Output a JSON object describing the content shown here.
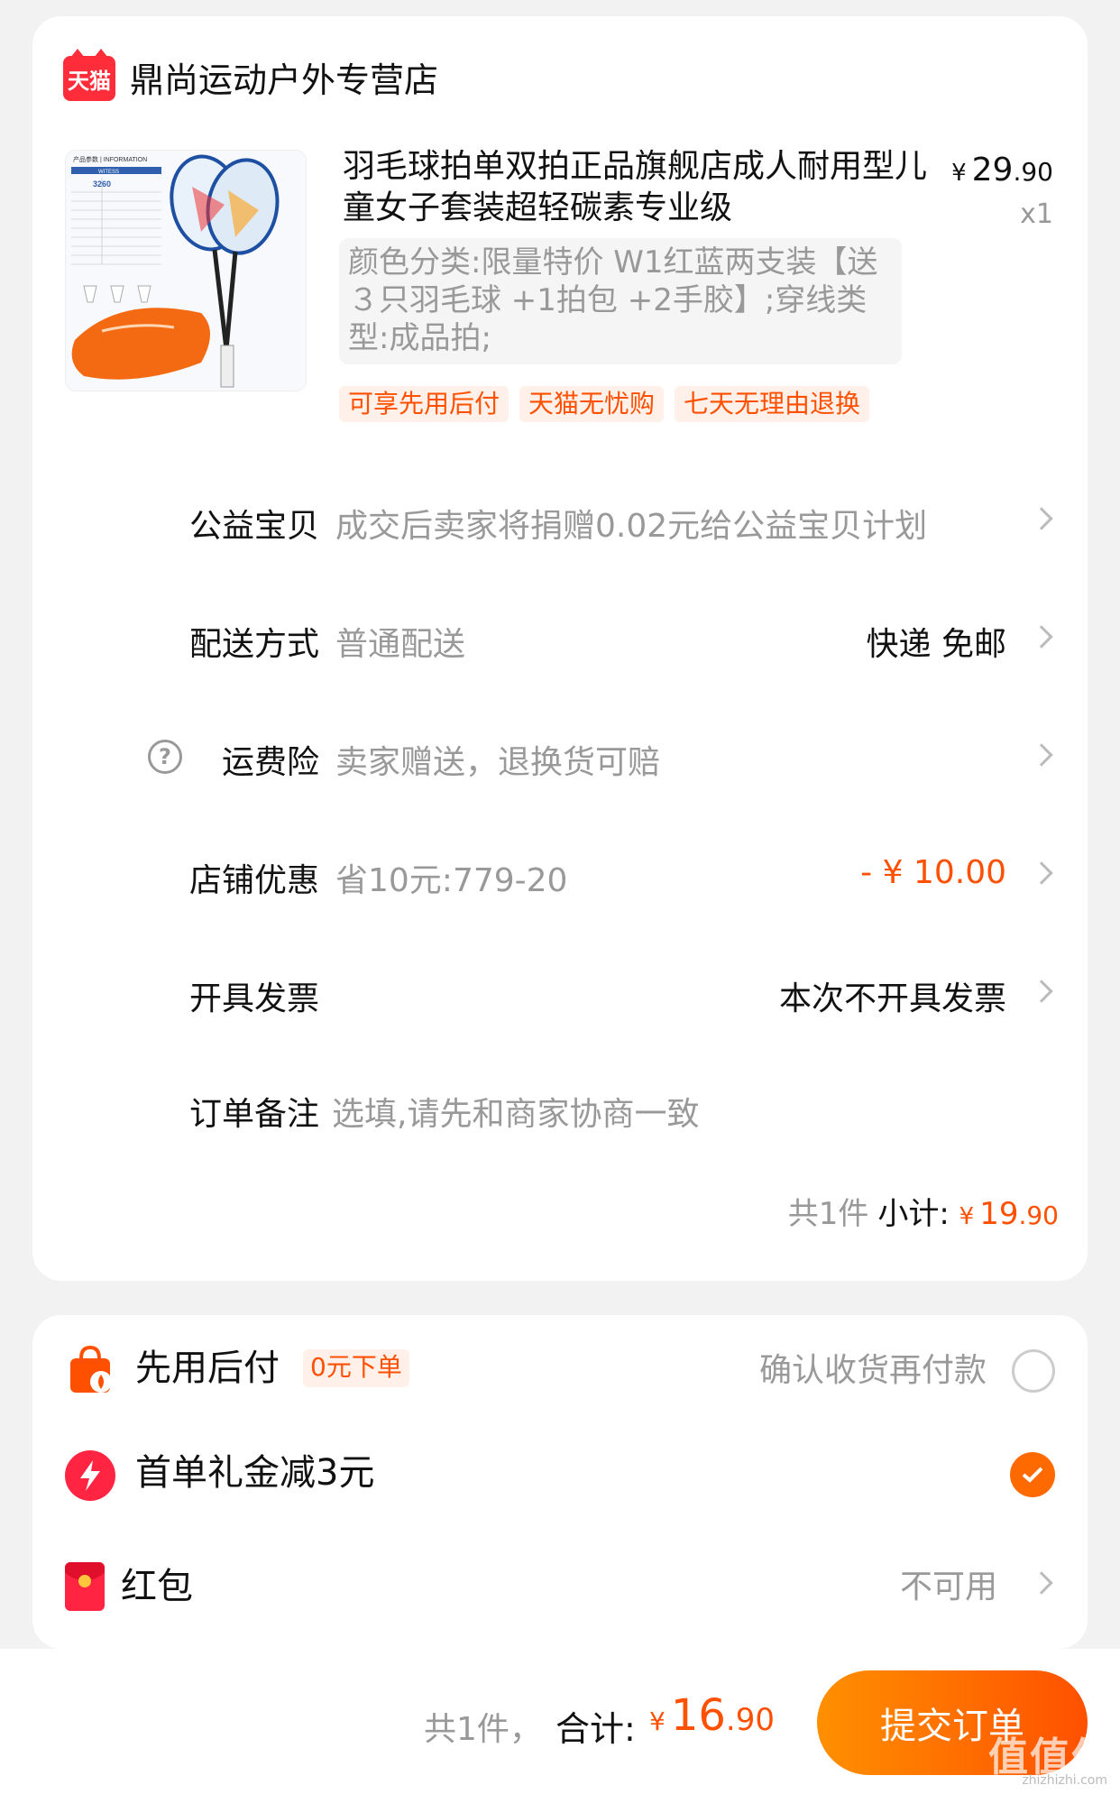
{
  "store": {
    "logo_text": "天猫",
    "name": "鼎尚运动户外专营店"
  },
  "product": {
    "title": "羽毛球拍单双拍正品旗舰店成人耐用型儿童女子套装超轻碳素专业级",
    "price_symbol": "¥",
    "price_int": "29",
    "price_dec": ".90",
    "quantity": "x1",
    "sku": "颜色分类:限量特价 W1红蓝两支装【送３只羽毛球 +1拍包 +2手胶】;穿线类型:成品拍;",
    "tags": [
      "可享先用后付",
      "天猫无忧购",
      "七天无理由退换"
    ],
    "image_text": {
      "header": "产品参数 | INFORMATION",
      "brand": "WITESS",
      "model": "3260"
    }
  },
  "rows": {
    "charity": {
      "label": "公益宝贝",
      "desc": "成交后卖家将捐赠0.02元给公益宝贝计划"
    },
    "delivery": {
      "label": "配送方式",
      "desc": "普通配送",
      "value": "快递 免邮"
    },
    "insurance": {
      "icon": "?",
      "label": "运费险",
      "desc": "卖家赠送，退换货可赔"
    },
    "discount": {
      "label": "店铺优惠",
      "desc": "省10元:779-20",
      "value": "- ¥ 10.00"
    },
    "invoice": {
      "label": "开具发票",
      "value": "本次不开具发票"
    },
    "note": {
      "label": "订单备注",
      "placeholder": "选填,请先和商家协商一致"
    }
  },
  "subtotal": {
    "count": "共1件",
    "label": "小计:",
    "symbol": "¥",
    "int": "19",
    "dec": ".90"
  },
  "payment": {
    "pay_later": {
      "title": "先用后付",
      "tag": "0元下单",
      "desc": "确认收货再付款",
      "selected": false
    },
    "first_order": {
      "title": "首单礼金减3元",
      "selected": true
    },
    "red_packet": {
      "title": "红包",
      "value": "不可用"
    }
  },
  "bottom_bar": {
    "count": "共1件，",
    "total_label": "合计:",
    "symbol": "¥",
    "int": "16",
    "dec": ".90",
    "submit": "提交订单",
    "watermark": "值值值",
    "watermark_url": "zhizhizhi.com"
  },
  "colors": {
    "accent": "#ff5000",
    "tmall_red": "#ff2d3a",
    "muted_text": "#999999",
    "card_bg": "#ffffff",
    "page_bg": "#f2f2f2"
  }
}
